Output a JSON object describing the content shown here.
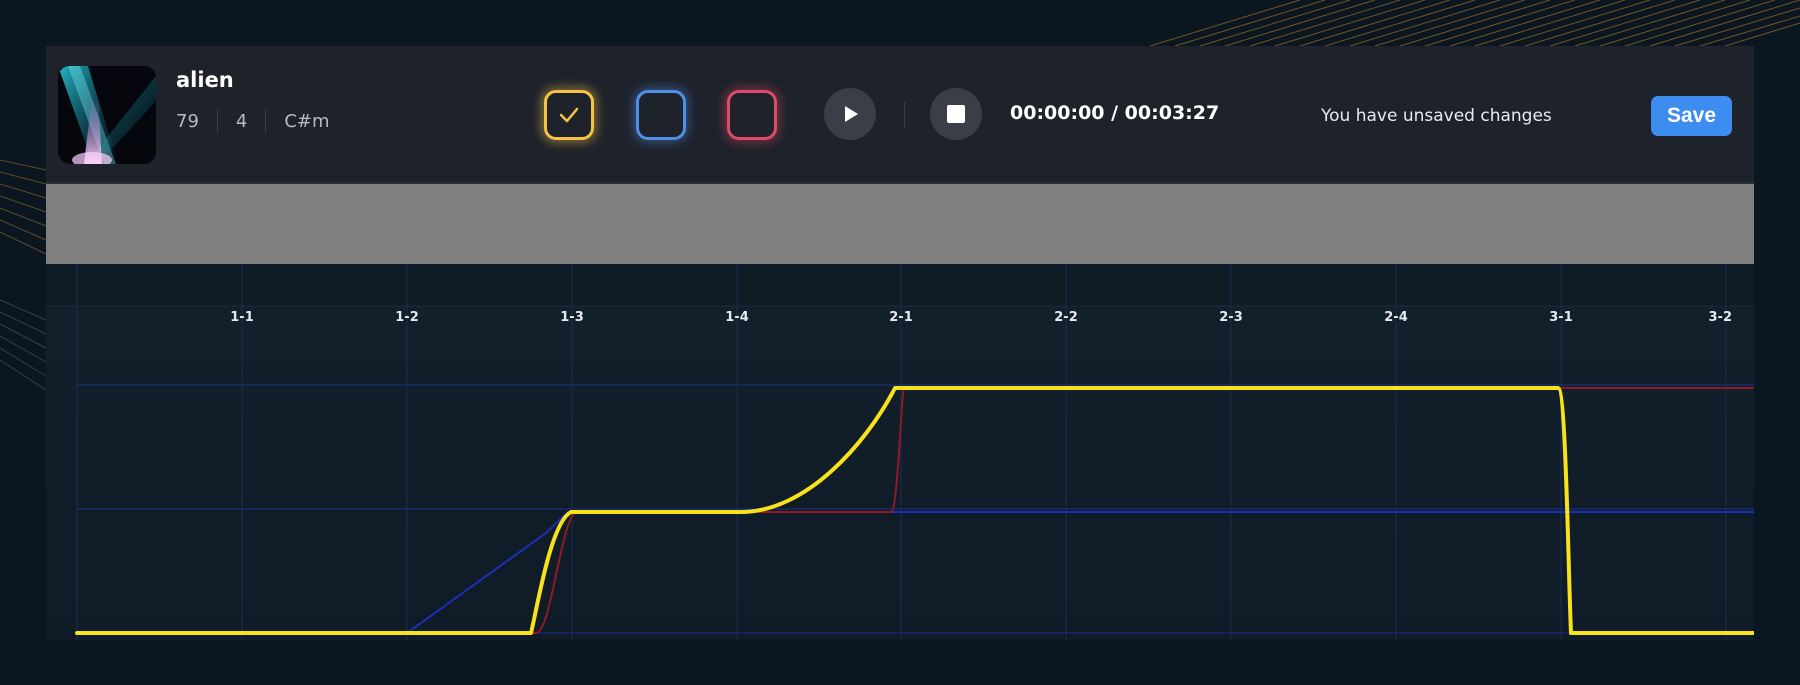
{
  "song": {
    "title": "alien",
    "bpm": "79",
    "beats": "4",
    "key": "C#m"
  },
  "color_channels": [
    {
      "name": "yellow",
      "color": "#f6c445",
      "checked": true
    },
    {
      "name": "blue",
      "color": "#4f8fe6",
      "checked": false
    },
    {
      "name": "red",
      "color": "#e24a6a",
      "checked": false
    }
  ],
  "transport": {
    "play_icon": "play-icon",
    "stop_icon": "stop-icon",
    "time_display": "00:00:00 / 00:03:27"
  },
  "status": {
    "unsaved_message": "You have unsaved changes"
  },
  "actions": {
    "save_label": "Save"
  },
  "timeline": {
    "ticks": [
      "1-1",
      "1-2",
      "1-3",
      "1-4",
      "2-1",
      "2-2",
      "2-3",
      "2-4",
      "3-1",
      "3-2"
    ]
  },
  "colors": {
    "yellow_curve": "#f7e21c",
    "red_curve": "#8e1a23",
    "blue_curve": "#1c2fb8"
  }
}
